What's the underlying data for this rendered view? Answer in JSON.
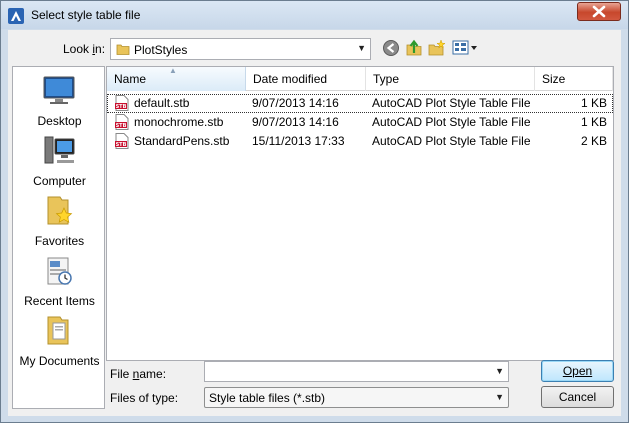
{
  "window": {
    "title": "Select style table file"
  },
  "icons": {
    "app": "app-logo-icon",
    "close": "close-icon",
    "back": "back-arrow-icon",
    "up": "up-folder-icon",
    "new_folder": "new-folder-icon",
    "views": "views-menu-icon",
    "file": "stb-file-icon"
  },
  "colors": {
    "close_button": "#c7472c",
    "stb_icon": "#c8102e"
  },
  "lookin": {
    "label": "Look in:",
    "folder": "PlotStyles"
  },
  "places": [
    {
      "label": "Desktop",
      "icon": "desktop-icon"
    },
    {
      "label": "Computer",
      "icon": "computer-icon"
    },
    {
      "label": "Favorites",
      "icon": "favorites-icon"
    },
    {
      "label": "Recent Items",
      "icon": "recent-items-icon"
    },
    {
      "label": "My Documents",
      "icon": "my-documents-icon"
    }
  ],
  "filelist": {
    "columns": [
      "Name",
      "Date modified",
      "Type",
      "Size"
    ],
    "rows": [
      {
        "name": "default.stb",
        "date": "9/07/2013 14:16",
        "type": "AutoCAD Plot Style Table File",
        "size": "1 KB"
      },
      {
        "name": "monochrome.stb",
        "date": "9/07/2013 14:16",
        "type": "AutoCAD Plot Style Table File",
        "size": "1 KB"
      },
      {
        "name": "StandardPens.stb",
        "date": "15/11/2013 17:33",
        "type": "AutoCAD Plot Style Table File",
        "size": "2 KB"
      }
    ]
  },
  "footer": {
    "filename_label": "File name:",
    "filename_value": "",
    "filetype_label": "Files of type:",
    "filetype_value": "Style table files (*.stb)",
    "open_label": "Open",
    "cancel_label": "Cancel"
  }
}
